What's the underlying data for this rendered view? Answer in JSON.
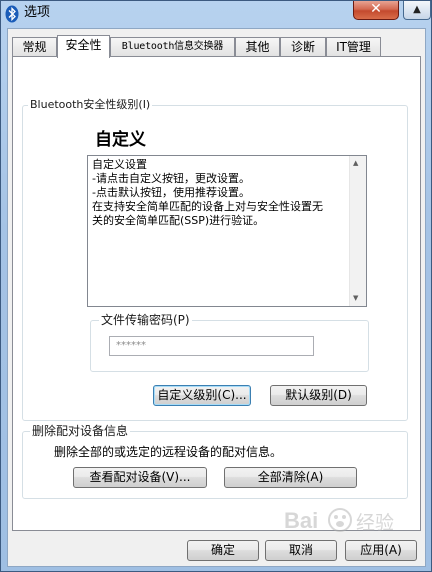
{
  "window": {
    "title": "选项"
  },
  "tabs": [
    {
      "label": "常规",
      "active": false
    },
    {
      "label": "安全性",
      "active": true
    },
    {
      "label": "Bluetooth信息交换器",
      "active": false
    },
    {
      "label": "其他",
      "active": false
    },
    {
      "label": "诊断",
      "active": false
    },
    {
      "label": "IT管理",
      "active": false
    }
  ],
  "security_group": {
    "legend": "Bluetooth安全性级别(I)",
    "level_title": "自定义",
    "description": [
      "自定义设置",
      "",
      "-请点击自定义按钮，更改设置。",
      "-点击默认按钮，使用推荐设置。",
      "",
      "在支持安全简单匹配的设备上对与安全性设置无",
      "关的安全简单匹配(SSP)进行验证。"
    ]
  },
  "file_transfer": {
    "legend": "文件传输密码(P)",
    "password_value": "******"
  },
  "buttons": {
    "custom_level": "自定义级别(C)...",
    "default_level": "默认级别(D)",
    "view_paired": "查看配对设备(V)...",
    "clear_all": "全部清除(A)",
    "ok": "确定",
    "cancel": "取消",
    "apply": "应用(A)"
  },
  "pairing_group": {
    "legend": "删除配对设备信息",
    "description": "删除全部的或选定的远程设备的配对信息。"
  },
  "icons": {
    "close": "close-icon",
    "app": "bluetooth-icon"
  },
  "watermark": {
    "text": "Bai",
    "suffix": "经验"
  }
}
